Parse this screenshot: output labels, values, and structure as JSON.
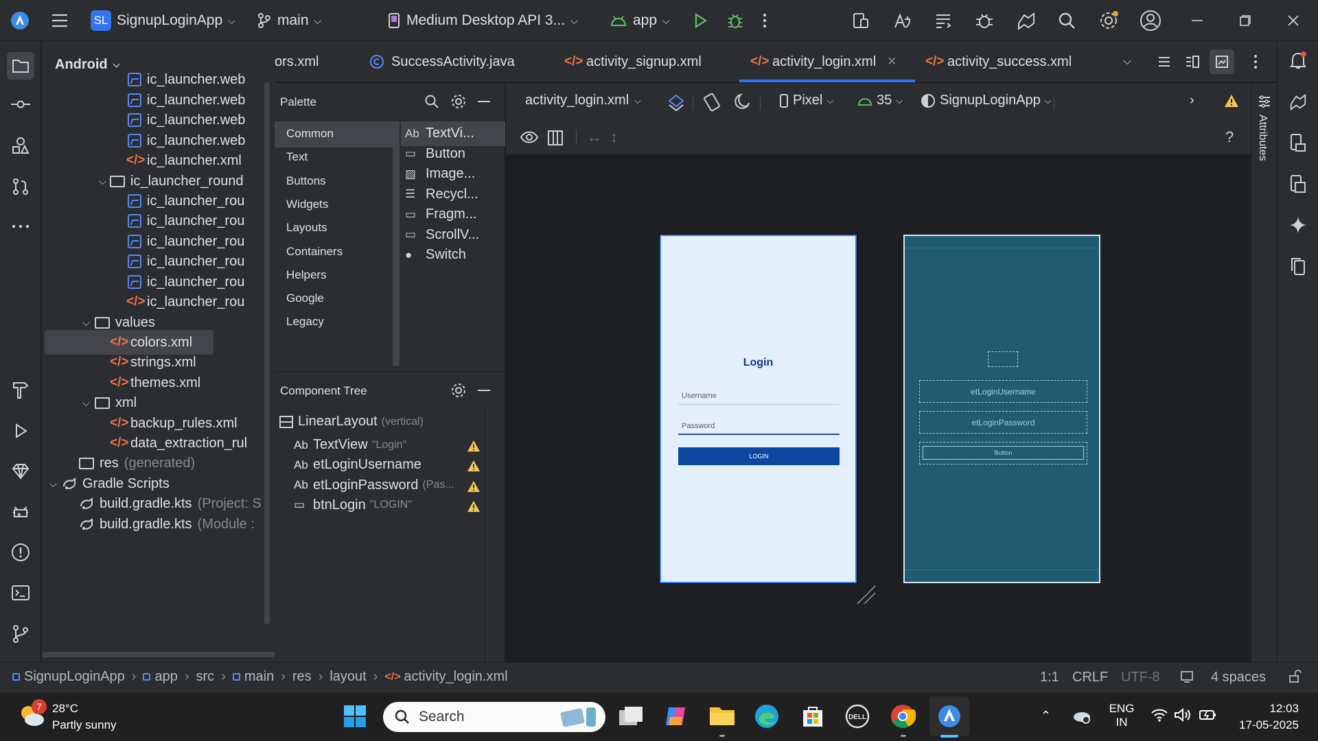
{
  "titlebar": {
    "project_badge": "SL",
    "project_name": "SignupLoginApp",
    "branch": "main",
    "device": "Medium Desktop API 3...",
    "run_config": "app"
  },
  "project_panel": {
    "view_selector": "Android",
    "rows": [
      {
        "label": "ic_launcher.web",
        "suffix": "",
        "icon": "image-icon"
      },
      {
        "label": "ic_launcher.web",
        "suffix": "",
        "icon": "image-icon"
      },
      {
        "label": "ic_launcher.web",
        "suffix": "",
        "icon": "image-icon"
      },
      {
        "label": "ic_launcher.web",
        "suffix": "",
        "icon": "image-icon"
      },
      {
        "label": "ic_launcher.xml",
        "suffix": "",
        "icon": "xml-icon"
      },
      {
        "label": "ic_launcher_round",
        "suffix": "",
        "icon": "folder-icon"
      },
      {
        "label": "ic_launcher_rou",
        "suffix": "",
        "icon": "image-icon"
      },
      {
        "label": "ic_launcher_rou",
        "suffix": "",
        "icon": "image-icon"
      },
      {
        "label": "ic_launcher_rou",
        "suffix": "",
        "icon": "image-icon"
      },
      {
        "label": "ic_launcher_rou",
        "suffix": "",
        "icon": "image-icon"
      },
      {
        "label": "ic_launcher_rou",
        "suffix": "",
        "icon": "image-icon"
      },
      {
        "label": "ic_launcher_rou",
        "suffix": "",
        "icon": "xml-icon"
      },
      {
        "label": "values",
        "suffix": "",
        "icon": "folder-icon"
      },
      {
        "label": "colors.xml",
        "suffix": "",
        "icon": "xml-icon"
      },
      {
        "label": "strings.xml",
        "suffix": "",
        "icon": "xml-icon"
      },
      {
        "label": "themes.xml",
        "suffix": "",
        "icon": "xml-icon"
      },
      {
        "label": "xml",
        "suffix": "",
        "icon": "folder-icon"
      },
      {
        "label": "backup_rules.xml",
        "suffix": "",
        "icon": "xml-icon"
      },
      {
        "label": "data_extraction_rul",
        "suffix": "",
        "icon": "xml-icon"
      },
      {
        "label": "res",
        "suffix": "(generated)",
        "icon": "folder-icon"
      },
      {
        "label": "Gradle Scripts",
        "suffix": "",
        "icon": "gradle-icon"
      },
      {
        "label": "build.gradle.kts",
        "suffix": "(Project: S",
        "icon": "gradle-icon"
      },
      {
        "label": "build.gradle.kts",
        "suffix": "(Module :",
        "icon": "gradle-icon"
      }
    ]
  },
  "tabs": [
    {
      "label": "ors.xml"
    },
    {
      "label": "SuccessActivity.java"
    },
    {
      "label": "activity_signup.xml"
    },
    {
      "label": "activity_login.xml"
    },
    {
      "label": "activity_success.xml"
    }
  ],
  "palette": {
    "title": "Palette",
    "categories": [
      "Common",
      "Text",
      "Buttons",
      "Widgets",
      "Layouts",
      "Containers",
      "Helpers",
      "Google",
      "Legacy"
    ],
    "items": [
      {
        "glyph": "Ab",
        "label": "TextVi..."
      },
      {
        "glyph": "▭",
        "label": "Button"
      },
      {
        "glyph": "▨",
        "label": "Image..."
      },
      {
        "glyph": "☰",
        "label": "Recycl..."
      },
      {
        "glyph": "▭",
        "label": "Fragm..."
      },
      {
        "glyph": "▭",
        "label": "ScrollV..."
      },
      {
        "glyph": "●",
        "label": "Switch"
      }
    ]
  },
  "component_tree": {
    "title": "Component Tree",
    "root": {
      "label": "LinearLayout",
      "hint": "(vertical)"
    },
    "children": [
      {
        "glyph": "Ab",
        "label": "TextView",
        "hint": "\"Login\""
      },
      {
        "glyph": "Ab",
        "label": "etLoginUsername",
        "hint": ""
      },
      {
        "glyph": "Ab",
        "label": "etLoginPassword",
        "hint": "(Pas..."
      },
      {
        "glyph": "▭",
        "label": "btnLogin",
        "hint": "\"LOGIN\""
      }
    ]
  },
  "design_toolbar": {
    "file": "activity_login.xml",
    "device": "Pixel",
    "api": "35",
    "theme": "SignupLoginApp"
  },
  "preview": {
    "title": "Login",
    "username_hint": "Username",
    "password_hint": "Password",
    "button": "LOGIN"
  },
  "blueprint": {
    "username": "etLoginUsername",
    "password": "etLoginPassword",
    "button": "Button"
  },
  "attributes_label": "Attributes",
  "statusbar": {
    "crumbs": [
      "SignupLoginApp",
      "app",
      "src",
      "main",
      "res",
      "layout",
      "activity_login.xml"
    ],
    "position": "1:1",
    "line_sep": "CRLF",
    "encoding": "UTF-8",
    "indent": "4 spaces"
  },
  "taskbar": {
    "weather_badge": "7",
    "temp": "28°C",
    "weather": "Partly sunny",
    "search": "Search",
    "lang1": "ENG",
    "lang2": "IN",
    "time": "12:03",
    "date": "17-05-2025"
  },
  "colors": {
    "accent": "#548af7",
    "preview_bg": "#e3f0fc",
    "button": "#0d47a1",
    "blueprint": "#1f5c70",
    "warning": "#f2c55c"
  }
}
